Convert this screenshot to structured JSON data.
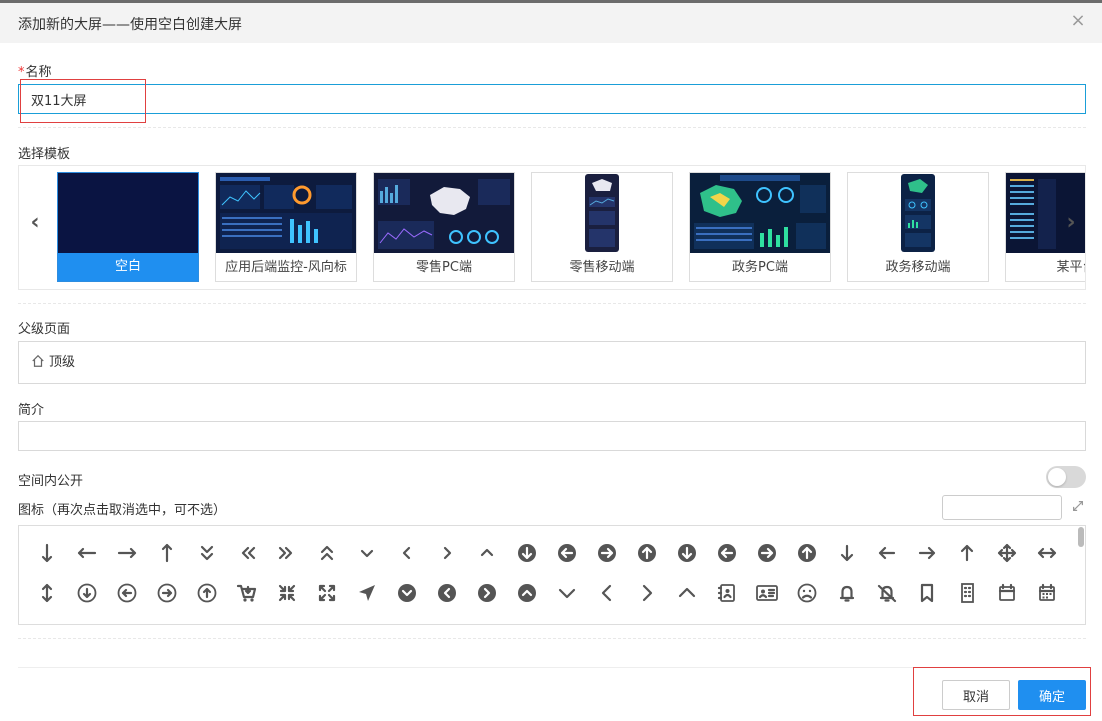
{
  "dialog": {
    "title": "添加新的大屏——使用空白创建大屏",
    "close_icon": "×"
  },
  "form": {
    "name_required": "*",
    "name_label": "名称",
    "name_value": "双11大屏",
    "template_label": "选择模板",
    "parent_label": "父级页面",
    "parent_value": "顶级",
    "intro_label": "简介",
    "intro_value": "",
    "public_label": "空间内公开",
    "public_enabled": false,
    "icon_label": "图标（再次点击取消选中，可不选）",
    "icon_search_value": ""
  },
  "carousel": {
    "prev_icon": "‹",
    "next_icon": "›",
    "templates": [
      {
        "name": "空白",
        "selected": true
      },
      {
        "name": "应用后端监控-风向标",
        "selected": false
      },
      {
        "name": "零售PC端",
        "selected": false
      },
      {
        "name": "零售移动端",
        "selected": false
      },
      {
        "name": "政务PC端",
        "selected": false
      },
      {
        "name": "政务移动端",
        "selected": false
      },
      {
        "name": "某平台",
        "selected": false
      }
    ]
  },
  "icons": {
    "row1": [
      "arrow-down-long",
      "arrow-left-long",
      "arrow-right-long",
      "arrow-up-long",
      "angles-down",
      "angles-left",
      "angles-right",
      "angles-up",
      "angle-down",
      "angle-left",
      "angle-right",
      "angle-up",
      "circle-arrow-down",
      "circle-arrow-left",
      "circle-arrow-right",
      "circle-arrow-up",
      "circle-arrow-down-o",
      "circle-arrow-left-o",
      "circle-arrow-right-o",
      "circle-arrow-up-o",
      "arrow-down",
      "arrow-left",
      "arrow-right",
      "arrow-up",
      "arrows-move",
      "arrows-h"
    ],
    "row2": [
      "arrows-v",
      "circle-down-o",
      "circle-left-o",
      "circle-right-o",
      "circle-up-o",
      "cart-arrow-down",
      "compress",
      "expand",
      "location-arrow",
      "chevron-circle-down",
      "chevron-circle-left",
      "chevron-circle-right",
      "chevron-circle-up",
      "chevron-down",
      "chevron-left",
      "chevron-right",
      "chevron-up",
      "address-book",
      "address-card",
      "frown",
      "bell",
      "bell-slash",
      "bookmark",
      "building",
      "calendar",
      "calendar-days"
    ]
  },
  "footer": {
    "cancel_label": "取消",
    "ok_label": "确定"
  },
  "colors": {
    "primary": "#1f8ff0",
    "highlight_box": "#e04040",
    "icon": "#555555"
  }
}
